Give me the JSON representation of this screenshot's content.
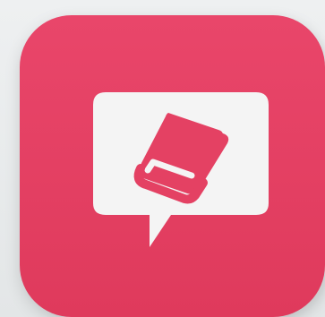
{
  "icon": {
    "name": "chat-book-app-icon",
    "symbol": "book-icon",
    "bubble": "speech-bubble-icon"
  },
  "colors": {
    "background": "#e7e9ea",
    "icon_background": "#e44163",
    "bubble": "#f4f4f4",
    "book": "#e44163"
  }
}
